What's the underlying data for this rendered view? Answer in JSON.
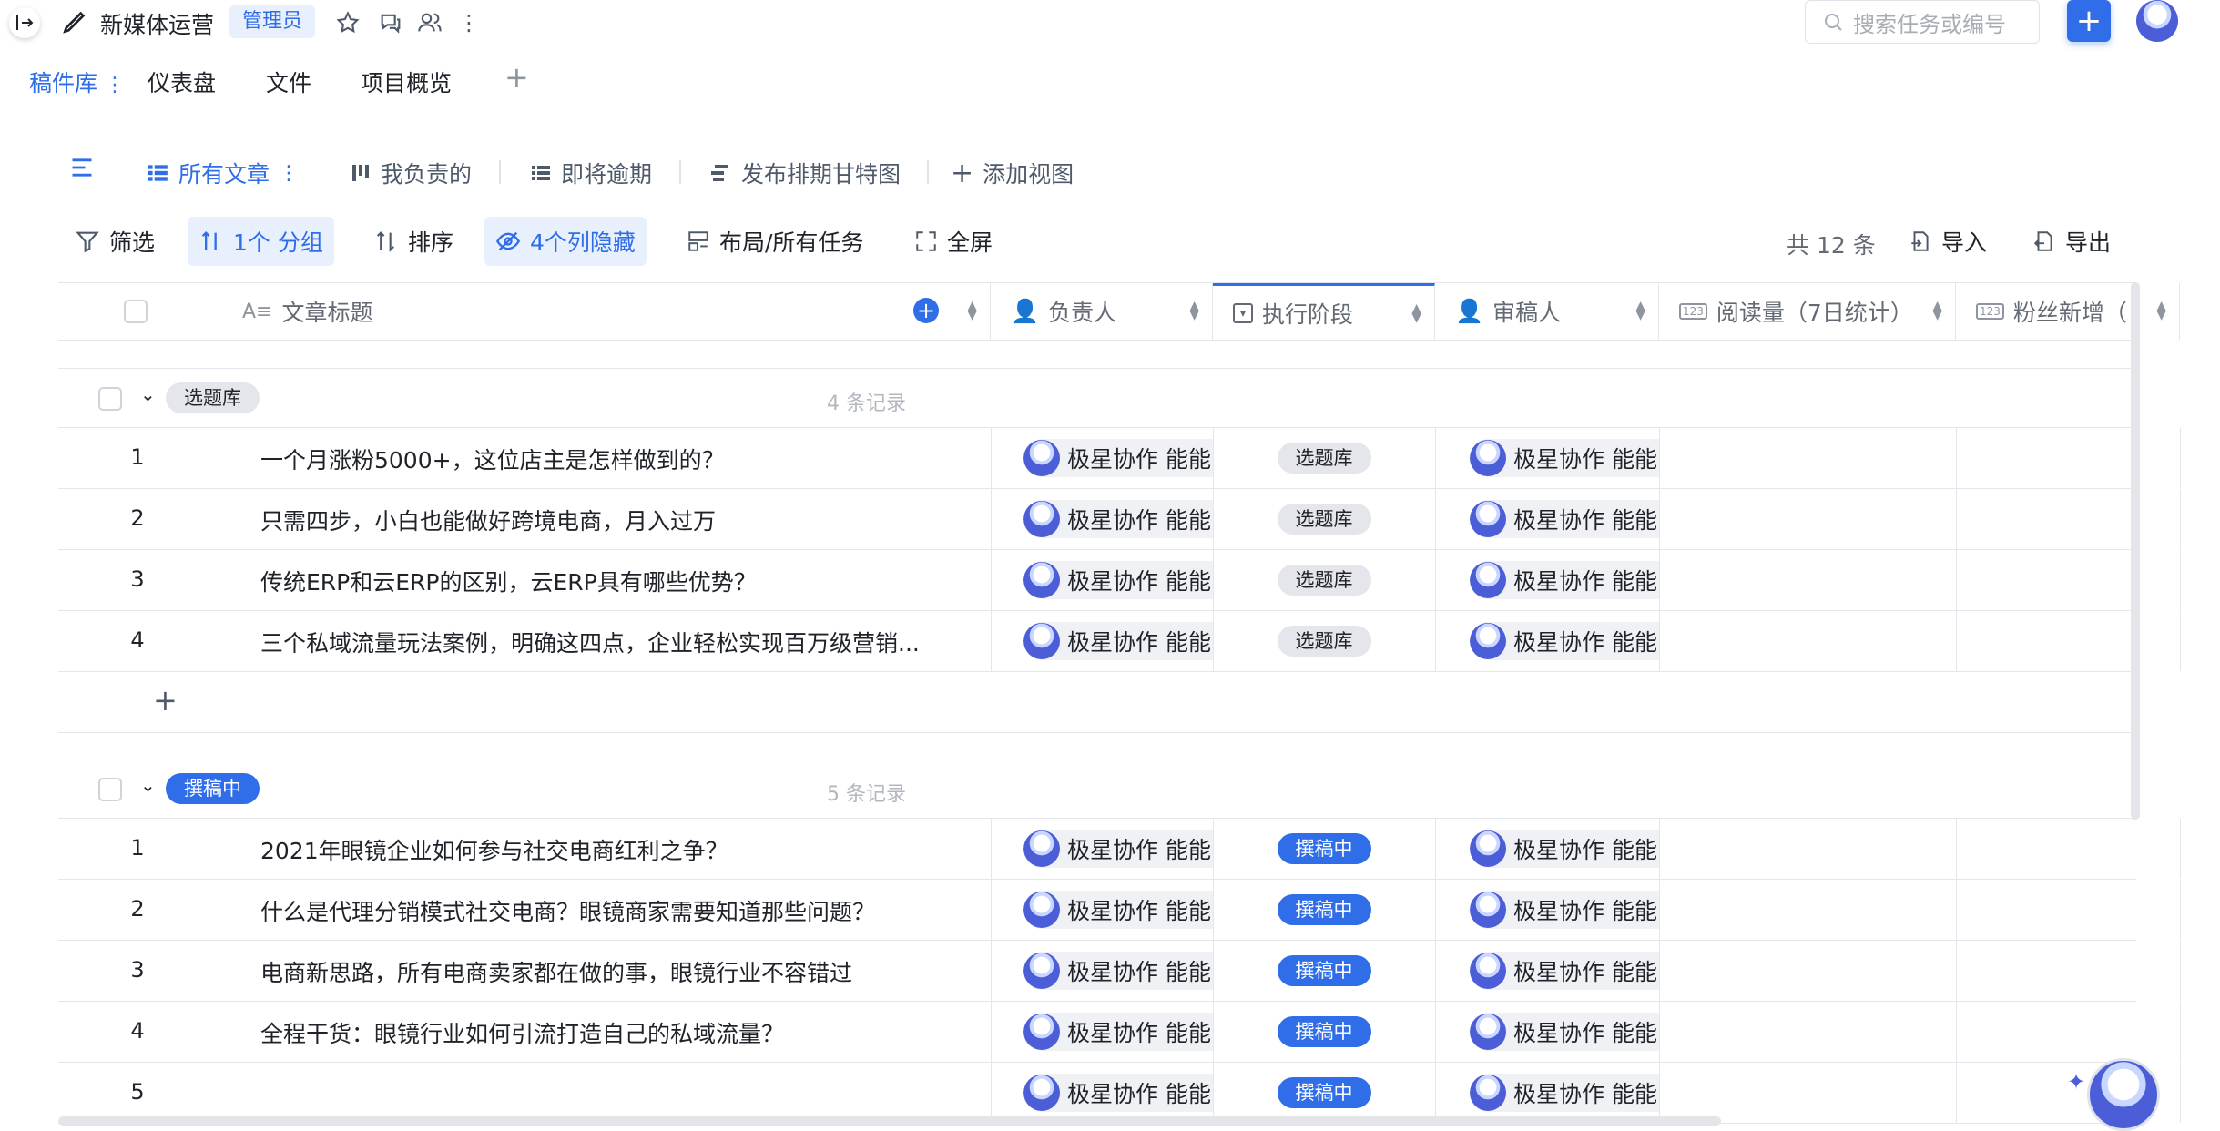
{
  "header": {
    "project_name": "新媒体运营",
    "role_badge": "管理员",
    "search_placeholder": "搜索任务或编号",
    "add_label": "+"
  },
  "modules": [
    {
      "label": "稿件库",
      "active": true
    },
    {
      "label": "仪表盘"
    },
    {
      "label": "文件"
    },
    {
      "label": "项目概览"
    }
  ],
  "module_add": "+",
  "views": {
    "all_articles": "所有文章",
    "mine": "我负责的",
    "due_soon": "即将逾期",
    "gantt": "发布排期甘特图",
    "add_view": "添加视图"
  },
  "toolbar": {
    "filter": "筛选",
    "group": "1个 分组",
    "sort": "排序",
    "hidden_cols": "4个列隐藏",
    "layout": "布局/所有任务",
    "fullscreen": "全屏",
    "total": "共 12 条",
    "import": "导入",
    "export": "导出"
  },
  "columns": {
    "title": "文章标题",
    "owner": "负责人",
    "stage": "执行阶段",
    "reviewer": "审稿人",
    "reads": "阅读量（7日统计）",
    "fans": "粉丝新增（"
  },
  "user_name": "极星协作 能能",
  "groups": [
    {
      "label": "选题库",
      "count": "4 条记录",
      "rows": [
        {
          "no": "1",
          "title": "一个月涨粉5000+，这位店主是怎样做到的？",
          "stage": "选题库"
        },
        {
          "no": "2",
          "title": "只需四步，小白也能做好跨境电商，月入过万",
          "stage": "选题库"
        },
        {
          "no": "3",
          "title": "传统ERP和云ERP的区别，云ERP具有哪些优势？",
          "stage": "选题库"
        },
        {
          "no": "4",
          "title": "三个私域流量玩法案例，明确这四点，企业轻松实现百万级营销...",
          "stage": "选题库"
        }
      ],
      "add_row": "+"
    },
    {
      "label": "撰稿中",
      "count": "5 条记录",
      "rows": [
        {
          "no": "1",
          "title": "2021年眼镜企业如何参与社交电商红利之争？",
          "stage": "撰稿中"
        },
        {
          "no": "2",
          "title": "什么是代理分销模式社交电商？眼镜商家需要知道那些问题？",
          "stage": "撰稿中"
        },
        {
          "no": "3",
          "title": "电商新思路，所有电商卖家都在做的事，眼镜行业不容错过",
          "stage": "撰稿中"
        },
        {
          "no": "4",
          "title": "全程干货：眼镜行业如何引流打造自己的私域流量？",
          "stage": "撰稿中"
        },
        {
          "no": "5",
          "title": "",
          "stage": "撰稿中"
        }
      ]
    }
  ]
}
